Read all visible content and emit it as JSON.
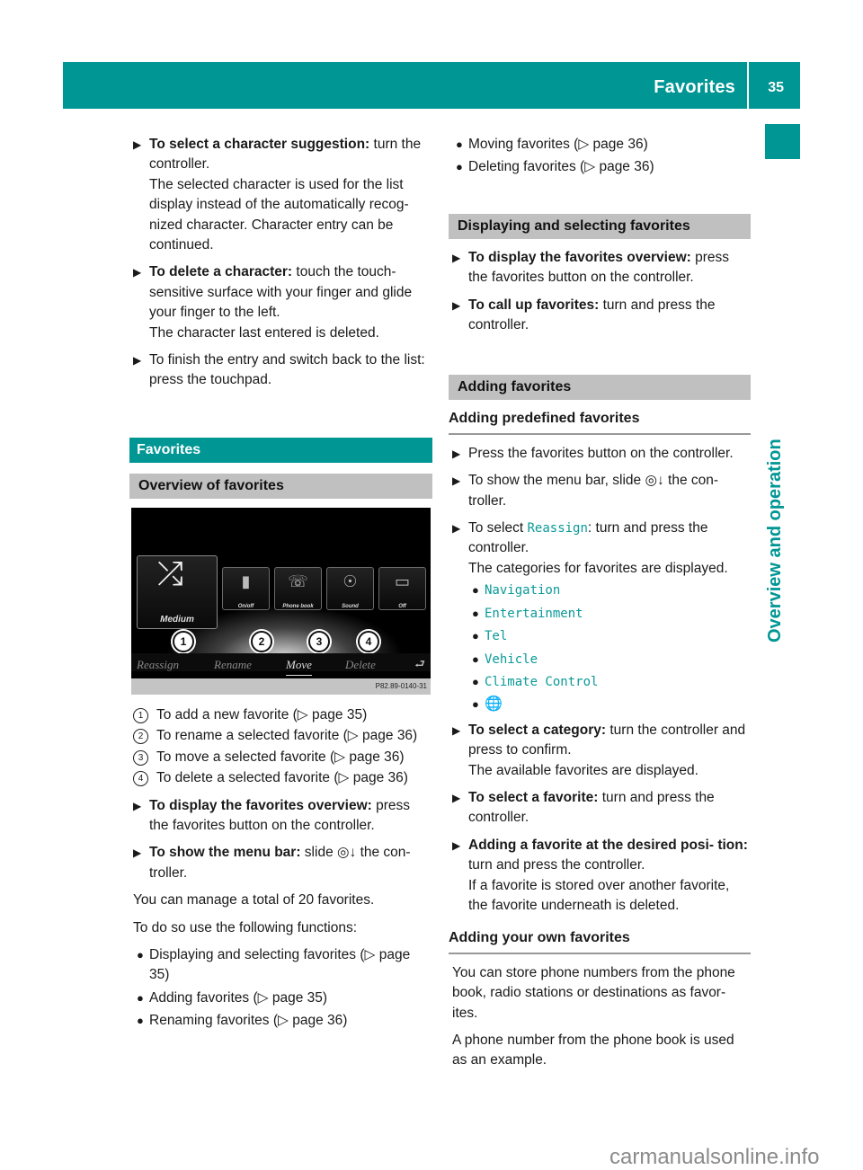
{
  "header": {
    "title": "Favorites",
    "page_number": "35"
  },
  "side_tab": {
    "label": "Overview and operation"
  },
  "left": {
    "steps_top": [
      {
        "bold": "To select a character suggestion:",
        "text": " turn the controller.",
        "extra": "The selected character is used for the list display instead of the automatically recog- nized character. Character entry can be continued."
      },
      {
        "bold": "To delete a character:",
        "text": " touch the touch- sensitive surface with your finger and glide your finger to the left.",
        "extra": "The character last entered is deleted."
      },
      {
        "bold": "",
        "text": "To finish the entry and switch back to the list: press the touchpad.",
        "extra": ""
      }
    ],
    "section_title": "Favorites",
    "subsection_title": "Overview of favorites",
    "screen": {
      "main_tile": {
        "label": "Medium",
        "icon": "shuffle-icon"
      },
      "tiles": [
        {
          "label": "On/off",
          "icon": "thermometer-icon"
        },
        {
          "label": "Phone book",
          "icon": "phone-icon"
        },
        {
          "label": "Sound",
          "icon": "sound-dial-icon"
        },
        {
          "label": "Off",
          "icon": "display-off-icon"
        }
      ],
      "callouts": [
        "1",
        "2",
        "3",
        "4"
      ],
      "menu": [
        "Reassign",
        "Rename",
        "Move",
        "Delete"
      ],
      "menu_active": "Move",
      "back_icon": "back-arrow-icon",
      "caption": "P82.89-0140-31"
    },
    "legend": [
      {
        "num": "1",
        "text": "To add a new favorite (▷ page 35)"
      },
      {
        "num": "2",
        "text": "To rename a selected favorite (▷ page 36)"
      },
      {
        "num": "3",
        "text": "To move a selected favorite (▷ page 36)"
      },
      {
        "num": "4",
        "text": "To delete a selected favorite (▷ page 36)"
      }
    ],
    "steps_bottom": [
      {
        "bold": "To display the favorites overview:",
        "text": " press the favorites button on the controller."
      },
      {
        "bold": "To show the menu bar:",
        "text": " slide ◎↓ the con- troller."
      }
    ],
    "para1": "You can manage a total of 20 favorites.",
    "para2": "To do so use the following functions:",
    "functions": [
      "Displaying and selecting favorites (▷ page 35)",
      "Adding favorites (▷ page 35)",
      "Renaming favorites (▷ page 36)"
    ]
  },
  "right": {
    "functions": [
      "Moving favorites (▷ page 36)",
      "Deleting favorites (▷ page 36)"
    ],
    "section_display": "Displaying and selecting favorites",
    "steps_display": [
      {
        "bold": "To display the favorites overview:",
        "text": " press the favorites button on the controller."
      },
      {
        "bold": "To call up favorites:",
        "text": " turn and press the controller."
      }
    ],
    "section_adding": "Adding favorites",
    "sub_predefined": "Adding predefined favorites",
    "steps_predefined": [
      {
        "text": "Press the favorites button on the controller."
      },
      {
        "text": "To show the menu bar, slide ◎↓ the con- troller."
      }
    ],
    "reassign_prefix": "To select ",
    "reassign_code": "Reassign",
    "reassign_suffix": ": turn and press the controller.",
    "reassign_extra": "The categories for favorites are displayed.",
    "categories": [
      "Navigation",
      "Entertainment",
      "Tel",
      "Vehicle",
      "Climate Control"
    ],
    "category_globe_icon": "globe-icon",
    "steps_select": [
      {
        "bold": "To select a category:",
        "text": " turn the controller and press to confirm.",
        "extra": "The available favorites are displayed."
      },
      {
        "bold": "To select a favorite:",
        "text": " turn and press the controller.",
        "extra": ""
      },
      {
        "bold": "Adding a favorite at the desired posi- tion:",
        "text": " turn and press the controller.",
        "extra": "If a favorite is stored over another favorite, the favorite underneath is deleted."
      }
    ],
    "sub_own": "Adding your own favorites",
    "para_own1": "You can store phone numbers from the phone book, radio stations or destinations as favor- ites.",
    "para_own2": "A phone number from the phone book is used as an example."
  },
  "footer": {
    "watermark": "carmanualsonline.info"
  },
  "colors": {
    "accent": "#009694",
    "section_grey": "#c0c0c0"
  }
}
